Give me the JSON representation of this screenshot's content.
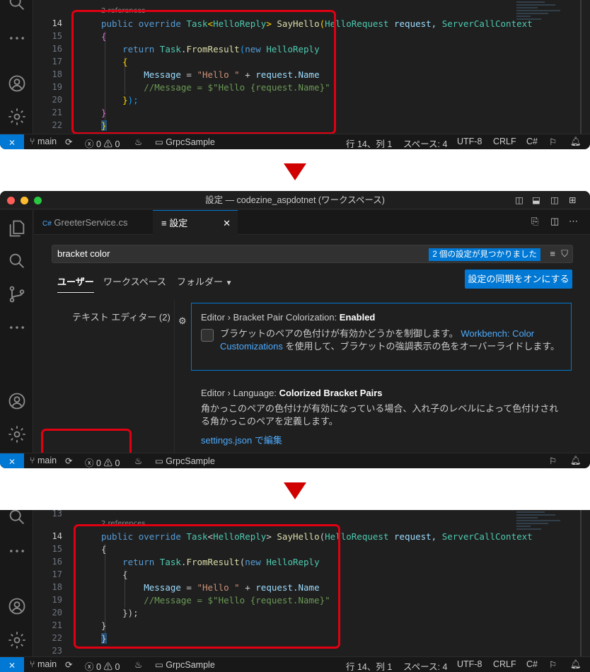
{
  "panel1": {
    "codelens": "2 references",
    "line_numbers": [
      "14",
      "15",
      "16",
      "17",
      "18",
      "19",
      "20",
      "21",
      "22"
    ],
    "code": {
      "l14_public": "public",
      "l14_override": "override",
      "l14_task": "Task",
      "l14_lt": "<",
      "l14_reply": "HelloReply",
      "l14_gt": ">",
      "l14_method": "SayHello",
      "l14_paren": "(",
      "l14_req_type": "HelloRequest",
      "l14_req": "request,",
      "l14_ctx_type": "ServerCallContext",
      "open_brace": "{",
      "return": "return",
      "task2": "Task",
      "dot": ".",
      "fromresult": "FromResult",
      "paren": "(",
      "new": "new",
      "helloreply": "HelloReply",
      "inner_open": "{",
      "message": "Message",
      "eq": " = ",
      "hello_str": "\"Hello \"",
      "plus": " + ",
      "request": "request",
      "name": ".Name",
      "comment": "//Message = $\"Hello {request.Name}\"",
      "inner_close": "}",
      "close_paren": ");",
      "close_brace": "}",
      "end_brace": "}"
    }
  },
  "panel3": {
    "codelens": "2 references",
    "line_numbers": [
      "13",
      "14",
      "15",
      "16",
      "17",
      "18",
      "19",
      "20",
      "21",
      "22",
      "23"
    ]
  },
  "statusbar": {
    "branch": "main",
    "errors": "0",
    "warnings": "0",
    "folder": "GrpcSample",
    "position": "行 14、列 1",
    "spaces": "スペース: 4",
    "encoding": "UTF-8",
    "eol": "CRLF",
    "language": "C#"
  },
  "window": {
    "title": "設定 — codezine_aspdotnet (ワークスペース)"
  },
  "tabs": [
    {
      "icon": "C#",
      "label": "GreeterService.cs"
    },
    {
      "icon": "≡",
      "label": "設定"
    }
  ],
  "settings_ui": {
    "search_value": "bracket color",
    "result_badge": "2 個の設定が見つかりました",
    "scopes": [
      "ユーザー",
      "ワークスペース",
      "フォルダー"
    ],
    "sync_button": "設定の同期をオンにする",
    "toc_item": "テキスト エディター (2)",
    "setting1": {
      "category": "Editor › Bracket Pair Colorization: ",
      "name": "Enabled",
      "desc_1": "ブラケットのペアの色付けが有効かどうかを制御します。",
      "link": "Workbench: Color",
      "link2": "Customizations",
      "desc_2": " を使用して、ブラケットの強調表示の色をオーバーライドします。"
    },
    "setting2": {
      "category": "Editor › Language: ",
      "name": "Colorized Bracket Pairs",
      "desc_1": "角かっこのペアの色付けが有効になっている場合、入れ子のレベルによって色付けされ",
      "desc_2": "る角かっこのペアを定義します。",
      "link": "settings.json で編集"
    }
  },
  "colors": {
    "accent": "#0078d4",
    "highlight_box": "#e00012",
    "arrow": "#d10000",
    "bracket_level1": "#ffd700",
    "bracket_level2": "#da70d6",
    "bracket_level3": "#179fff"
  }
}
